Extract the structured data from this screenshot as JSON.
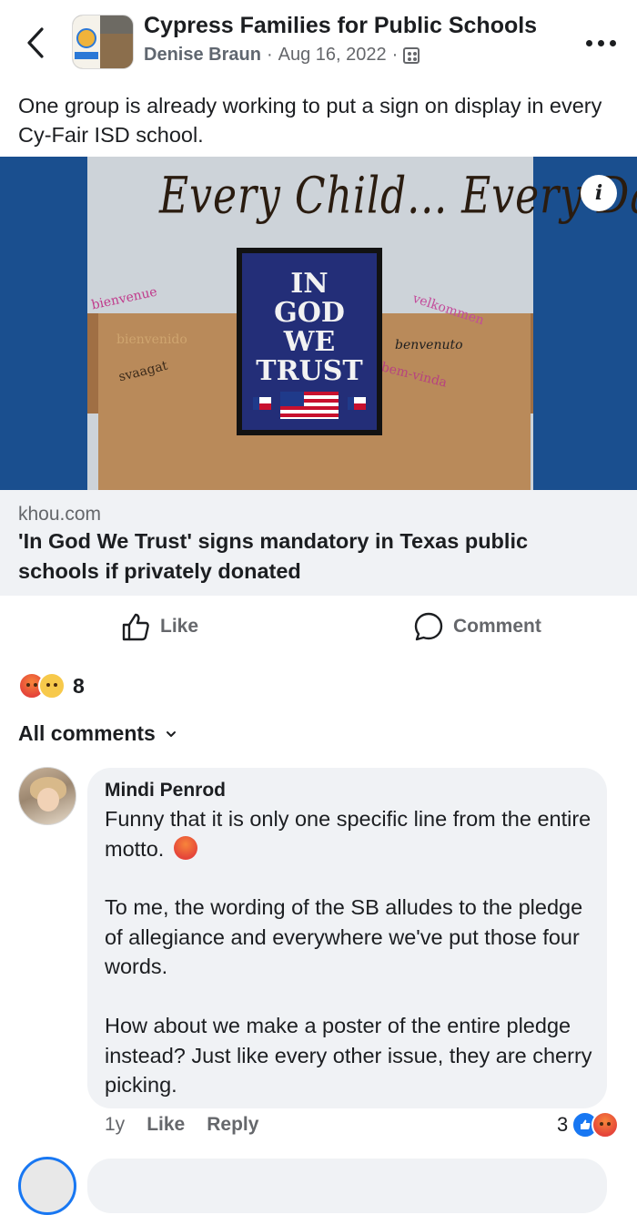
{
  "header": {
    "group_name": "Cypress Families for Public Schools",
    "author": "Denise Braun",
    "separator": "·",
    "date": "Aug 16, 2022",
    "privacy_icon": "group-members-icon",
    "more_icon": "more-dots-icon",
    "back_icon": "chevron-left-icon"
  },
  "post": {
    "text": "One group is already working to put a sign on display in every Cy-Fair ISD school."
  },
  "link": {
    "image": {
      "slogan": "Every Child... Every Day",
      "sign_lines": [
        "IN",
        "GOD",
        "WE",
        "TRUST"
      ],
      "welcome_words": [
        "benvenuto",
        "bienvenido",
        "svaagat",
        "velkommen",
        "bem-vinda",
        "bienvenue"
      ]
    },
    "info_icon": "i",
    "domain": "khou.com",
    "title": "'In God We Trust' signs mandatory in Texas public schools if privately donated"
  },
  "actions": {
    "like_label": "Like",
    "comment_label": "Comment"
  },
  "reactions": {
    "types": [
      "angry",
      "sad"
    ],
    "count": "8"
  },
  "comments_filter": {
    "label": "All comments"
  },
  "comment": {
    "author": "Mindi Penrod",
    "paragraph1": "Funny that it is only one specific line from the entire motto.",
    "paragraph2": "To me, the wording of the SB alludes to the pledge of allegiance and everywhere we've put those four words.",
    "paragraph3": "How about we make a poster of the entire pledge instead? Just like every other issue, they are cherry picking.",
    "time": "1y",
    "like_label": "Like",
    "reply_label": "Reply",
    "reaction_count": "3",
    "reaction_types": [
      "like",
      "angry"
    ]
  },
  "colors": {
    "accent": "#1877f2",
    "text_primary": "#1c1e21",
    "text_secondary": "#65676b",
    "bubble": "#f0f2f5"
  }
}
